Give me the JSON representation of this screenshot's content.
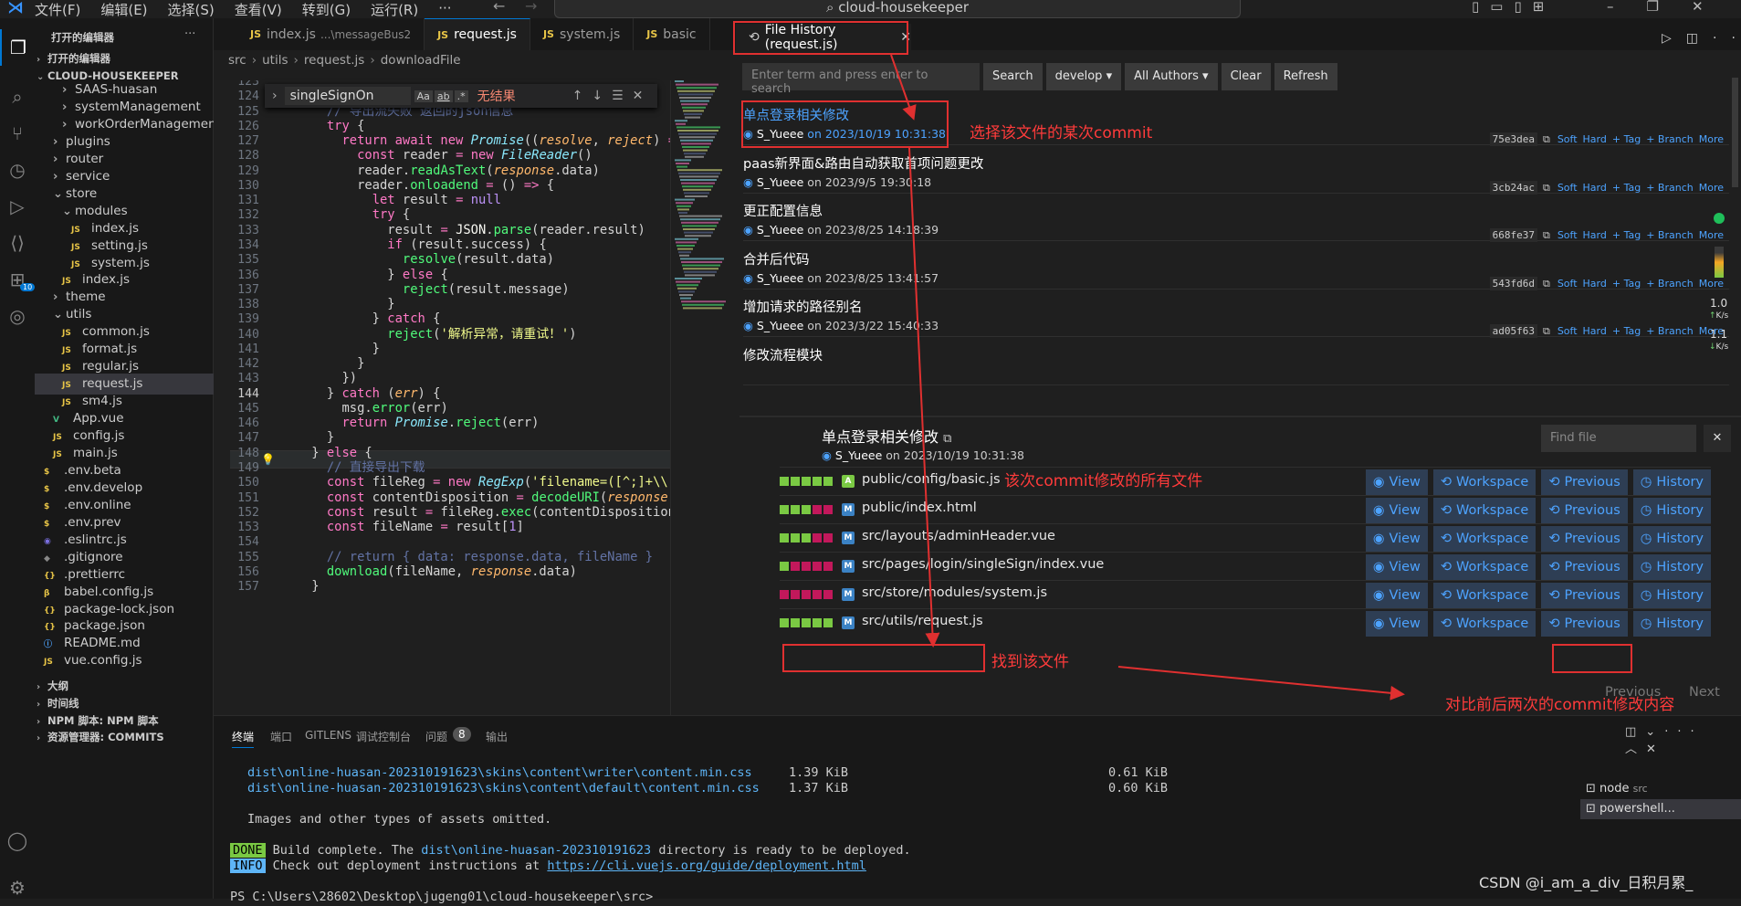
{
  "menu": [
    "文件(F)",
    "编辑(E)",
    "选择(S)",
    "查看(V)",
    "转到(G)",
    "运行(R)",
    "···"
  ],
  "window_search": "cloud-housekeeper",
  "sidebar": {
    "open_editors_header": "打开的编辑器",
    "open_editors_group": "打开的编辑器",
    "project_header": "CLOUD-HOUSEKEEPER",
    "items": [
      {
        "label": "SAAS-huasan",
        "indent": 2,
        "type": "folder-closed"
      },
      {
        "label": "systemManagement",
        "indent": 2,
        "type": "folder-closed"
      },
      {
        "label": "workOrderManagement",
        "indent": 2,
        "type": "folder-closed"
      },
      {
        "label": "plugins",
        "indent": 1,
        "type": "folder-closed"
      },
      {
        "label": "router",
        "indent": 1,
        "type": "folder-closed"
      },
      {
        "label": "service",
        "indent": 1,
        "type": "folder-closed"
      },
      {
        "label": "store",
        "indent": 1,
        "type": "folder-open"
      },
      {
        "label": "modules",
        "indent": 2,
        "type": "folder-open"
      },
      {
        "label": "index.js",
        "indent": 3,
        "type": "js"
      },
      {
        "label": "setting.js",
        "indent": 3,
        "type": "js"
      },
      {
        "label": "system.js",
        "indent": 3,
        "type": "js"
      },
      {
        "label": "index.js",
        "indent": 2,
        "type": "js"
      },
      {
        "label": "theme",
        "indent": 1,
        "type": "folder-closed"
      },
      {
        "label": "utils",
        "indent": 1,
        "type": "folder-open"
      },
      {
        "label": "common.js",
        "indent": 2,
        "type": "js"
      },
      {
        "label": "format.js",
        "indent": 2,
        "type": "js"
      },
      {
        "label": "regular.js",
        "indent": 2,
        "type": "js"
      },
      {
        "label": "request.js",
        "indent": 2,
        "type": "js",
        "selected": true
      },
      {
        "label": "sm4.js",
        "indent": 2,
        "type": "js"
      },
      {
        "label": "App.vue",
        "indent": 1,
        "type": "vue"
      },
      {
        "label": "config.js",
        "indent": 1,
        "type": "js"
      },
      {
        "label": "main.js",
        "indent": 1,
        "type": "js"
      },
      {
        "label": ".env.beta",
        "indent": 0,
        "type": "env"
      },
      {
        "label": ".env.develop",
        "indent": 0,
        "type": "env"
      },
      {
        "label": ".env.online",
        "indent": 0,
        "type": "env"
      },
      {
        "label": ".env.prev",
        "indent": 0,
        "type": "env"
      },
      {
        "label": ".eslintrc.js",
        "indent": 0,
        "type": "eslint"
      },
      {
        "label": ".gitignore",
        "indent": 0,
        "type": "git"
      },
      {
        "label": ".prettierrc",
        "indent": 0,
        "type": "json"
      },
      {
        "label": "babel.config.js",
        "indent": 0,
        "type": "babel"
      },
      {
        "label": "package-lock.json",
        "indent": 0,
        "type": "json"
      },
      {
        "label": "package.json",
        "indent": 0,
        "type": "json"
      },
      {
        "label": "README.md",
        "indent": 0,
        "type": "info"
      },
      {
        "label": "vue.config.js",
        "indent": 0,
        "type": "js"
      }
    ],
    "bottom_sections": [
      "大纲",
      "时间线",
      "NPM 脚本: NPM 脚本",
      "资源管理器: COMMITS"
    ]
  },
  "editor": {
    "tabs": [
      {
        "label": "index.js",
        "hint": "...\\messageBus2"
      },
      {
        "label": "request.js",
        "active": true
      },
      {
        "label": "system.js"
      },
      {
        "label": "basic"
      }
    ],
    "breadcrumb": [
      "src",
      "utils",
      "request.js",
      "downloadFile"
    ],
    "find": {
      "query": "singleSignOn",
      "result": "无结果",
      "opt1": "Aa",
      "opt2": "ab",
      "opt3": ".*"
    },
    "lines": [
      {
        "n": "123",
        "h": ""
      },
      {
        "n": "124",
        "h": ""
      },
      {
        "n": "125",
        "h": "<span class='cm'>      // 导出流失败 返回的json信息</span>"
      },
      {
        "n": "126",
        "h": "      <span class='kw'>try</span> {"
      },
      {
        "n": "127",
        "h": "        <span class='kw'>return await new</span> <span class='ty'>Promise</span>((<span class='pm'>resolve</span>, <span class='pm'>reject</span>) <span class='kw'>=&gt;</span> {"
      },
      {
        "n": "128",
        "h": "          <span class='kw'>const</span> reader <span class='kw'>=</span> <span class='kw'>new</span> <span class='ty'>FileReader</span>()"
      },
      {
        "n": "129",
        "h": "          reader.<span class='fn'>readAsText</span>(<span class='pm'>response</span>.data)"
      },
      {
        "n": "130",
        "h": "          reader.<span class='fn'>onloadend</span> <span class='kw'>=</span> () <span class='kw'>=&gt;</span> {"
      },
      {
        "n": "131",
        "h": "            <span class='kw'>let</span> result <span class='kw'>=</span> <span class='cn'>null</span>"
      },
      {
        "n": "132",
        "h": "            <span class='kw'>try</span> {"
      },
      {
        "n": "133",
        "h": "              result <span class='kw'>=</span> <span class='pr'>JSON</span>.<span class='fn'>parse</span>(reader.result)"
      },
      {
        "n": "134",
        "h": "              <span class='kw'>if</span> (result.success) {"
      },
      {
        "n": "135",
        "h": "                <span class='fn'>resolve</span>(result.data)"
      },
      {
        "n": "136",
        "h": "              } <span class='kw'>else</span> {"
      },
      {
        "n": "137",
        "h": "                <span class='fn'>reject</span>(result.message)"
      },
      {
        "n": "138",
        "h": "              }"
      },
      {
        "n": "139",
        "h": "            } <span class='kw'>catch</span> {"
      },
      {
        "n": "140",
        "h": "              <span class='fn'>reject</span>(<span class='str'>'解析异常，请重试！'</span>)"
      },
      {
        "n": "141",
        "h": "            }"
      },
      {
        "n": "142",
        "h": "          }"
      },
      {
        "n": "143",
        "h": "        })"
      },
      {
        "n": "144",
        "h": "      } <span class='kw'>catch</span> (<span class='pm'>err</span>) {"
      },
      {
        "n": "145",
        "h": "        msg.<span class='fn'>error</span>(err)"
      },
      {
        "n": "146",
        "h": "        <span class='kw'>return</span> <span class='ty'>Promise</span>.<span class='fn'>reject</span>(err)"
      },
      {
        "n": "147",
        "h": "      }"
      },
      {
        "n": "148",
        "h": "    } <span class='kw'>else</span> {"
      },
      {
        "n": "149",
        "h": "<span class='cm'>      // 直接导出下载</span>"
      },
      {
        "n": "150",
        "h": "      <span class='kw'>const</span> fileReg <span class='kw'>=</span> <span class='kw'>new</span> <span class='ty'>RegExp</span>(<span class='str'>'filename=([^;]+\\\\.[^\\\\</span>"
      },
      {
        "n": "151",
        "h": "      <span class='kw'>const</span> contentDisposition <span class='kw'>=</span> <span class='fn'>decodeURI</span>(<span class='pm'>response</span>.<span class='pr'>head</span>"
      },
      {
        "n": "152",
        "h": "      <span class='kw'>const</span> result <span class='kw'>=</span> fileReg.<span class='fn'>exec</span>(contentDisposition)"
      },
      {
        "n": "153",
        "h": "      <span class='kw'>const</span> fileName <span class='kw'>=</span> result[<span class='cn'>1</span>]"
      },
      {
        "n": "154",
        "h": ""
      },
      {
        "n": "155",
        "h": "<span class='cm'>      // return { data: response.data, fileName }</span>"
      },
      {
        "n": "156",
        "h": "      <span class='fn'>download</span>(fileName, <span class='pm'>response</span>.data)"
      },
      {
        "n": "157",
        "h": "    }"
      }
    ]
  },
  "file_history": {
    "tab_label": "File History (request.js)",
    "search_placeholder": "Enter term and press enter to search",
    "toolbar": {
      "search": "Search",
      "branch": "develop",
      "authors": "All Authors",
      "clear": "Clear",
      "refresh": "Refresh"
    },
    "commit_actions": [
      "Soft",
      "Hard",
      "+ Tag",
      "+ Branch",
      "More"
    ],
    "commits": [
      {
        "message": "单点登录相关修改",
        "author": "S_Yueee",
        "date": "on 2023/10/19 10:31:38",
        "hash": "75e3dea",
        "selected": true
      },
      {
        "message": "paas新界面&路由自动获取首项问题更改",
        "author": "S_Yueee",
        "date": "on 2023/9/5 19:30:18",
        "hash": "3cb24ac"
      },
      {
        "message": "更正配置信息",
        "author": "S_Yueee",
        "date": "on 2023/8/25 14:18:39",
        "hash": "668fe37"
      },
      {
        "message": "合并后代码",
        "author": "S_Yueee",
        "date": "on 2023/8/25 13:41:57",
        "hash": "543fd6d"
      },
      {
        "message": "增加请求的路径别名",
        "author": "S_Yueee",
        "date": "on 2023/3/22 15:40:33",
        "hash": "ad05f63"
      },
      {
        "message": "修改流程模块",
        "author": "",
        "date": "",
        "hash": ""
      }
    ],
    "detail": {
      "title": "单点登录相关修改",
      "author": "S_Yueee",
      "date": "on 2023/10/19 10:31:38",
      "find_placeholder": "Find file",
      "file_buttons": [
        "View",
        "Workspace",
        "Previous",
        "History"
      ],
      "files": [
        {
          "path": "public/config/basic.js",
          "status": "A",
          "bars": [
            "#7ac943",
            "#7ac943",
            "#7ac943",
            "#7ac943",
            "#7ac943"
          ]
        },
        {
          "path": "public/index.html",
          "status": "M",
          "bars": [
            "#7ac943",
            "#7ac943",
            "#7ac943",
            "#c2185b",
            "#c2185b"
          ]
        },
        {
          "path": "src/layouts/adminHeader.vue",
          "status": "M",
          "bars": [
            "#7ac943",
            "#7ac943",
            "#7ac943",
            "#c2185b",
            "#c2185b"
          ]
        },
        {
          "path": "src/pages/login/singleSign/index.vue",
          "status": "M",
          "bars": [
            "#7ac943",
            "#c2185b",
            "#c2185b",
            "#c2185b",
            "#c2185b"
          ]
        },
        {
          "path": "src/store/modules/system.js",
          "status": "M",
          "bars": [
            "#c2185b",
            "#c2185b",
            "#c2185b",
            "#c2185b",
            "#c2185b"
          ]
        },
        {
          "path": "src/utils/request.js",
          "status": "M",
          "bars": [
            "#7ac943",
            "#7ac943",
            "#7ac943",
            "#7ac943",
            "#7ac943"
          ]
        }
      ],
      "pager": {
        "previous": "Previous",
        "next": "Next"
      }
    }
  },
  "annotations": {
    "select_commit": "选择该文件的某次commit",
    "all_files": "该次commit修改的所有文件",
    "find_file": "找到该文件",
    "compare": "对比前后两次的commit修改内容"
  },
  "net_speed": {
    "up": "1.0",
    "up_unit": "K/s",
    "down": "1.1",
    "down_unit": "K/s"
  },
  "panel": {
    "tabs": [
      "终端",
      "端口",
      "GITLENS",
      "调试控制台",
      "问题",
      "输出"
    ],
    "problems_count": "8",
    "terminal_lines": [
      {
        "text": "dist\\online-huasan-202310191623\\skins\\content\\writer\\content.min.css",
        "size1": "1.39 KiB",
        "size2": "0.61 KiB"
      },
      {
        "text": "dist\\online-huasan-202310191623\\skins\\content\\default\\content.min.css",
        "size1": "1.37 KiB",
        "size2": "0.60 KiB"
      }
    ],
    "omitted": "Images and other types of assets omitted.",
    "done_badge": "DONE",
    "done_text_a": "Build complete. The ",
    "done_dir": "dist\\online-huasan-202310191623",
    "done_text_b": " directory is ready to be deployed.",
    "info_badge": "INFO",
    "info_text": "Check out deployment instructions at ",
    "info_link": "https://cli.vuejs.org/guide/deployment.html",
    "prompt": "PS C:\\Users\\28602\\Desktop\\jugeng01\\cloud-housekeeper\\src>",
    "terminals": [
      {
        "name": "node",
        "sub": "src"
      },
      {
        "name": "powershell...",
        "sub": ""
      }
    ]
  },
  "watermark": "CSDN @i_am_a_div_日积月累_"
}
